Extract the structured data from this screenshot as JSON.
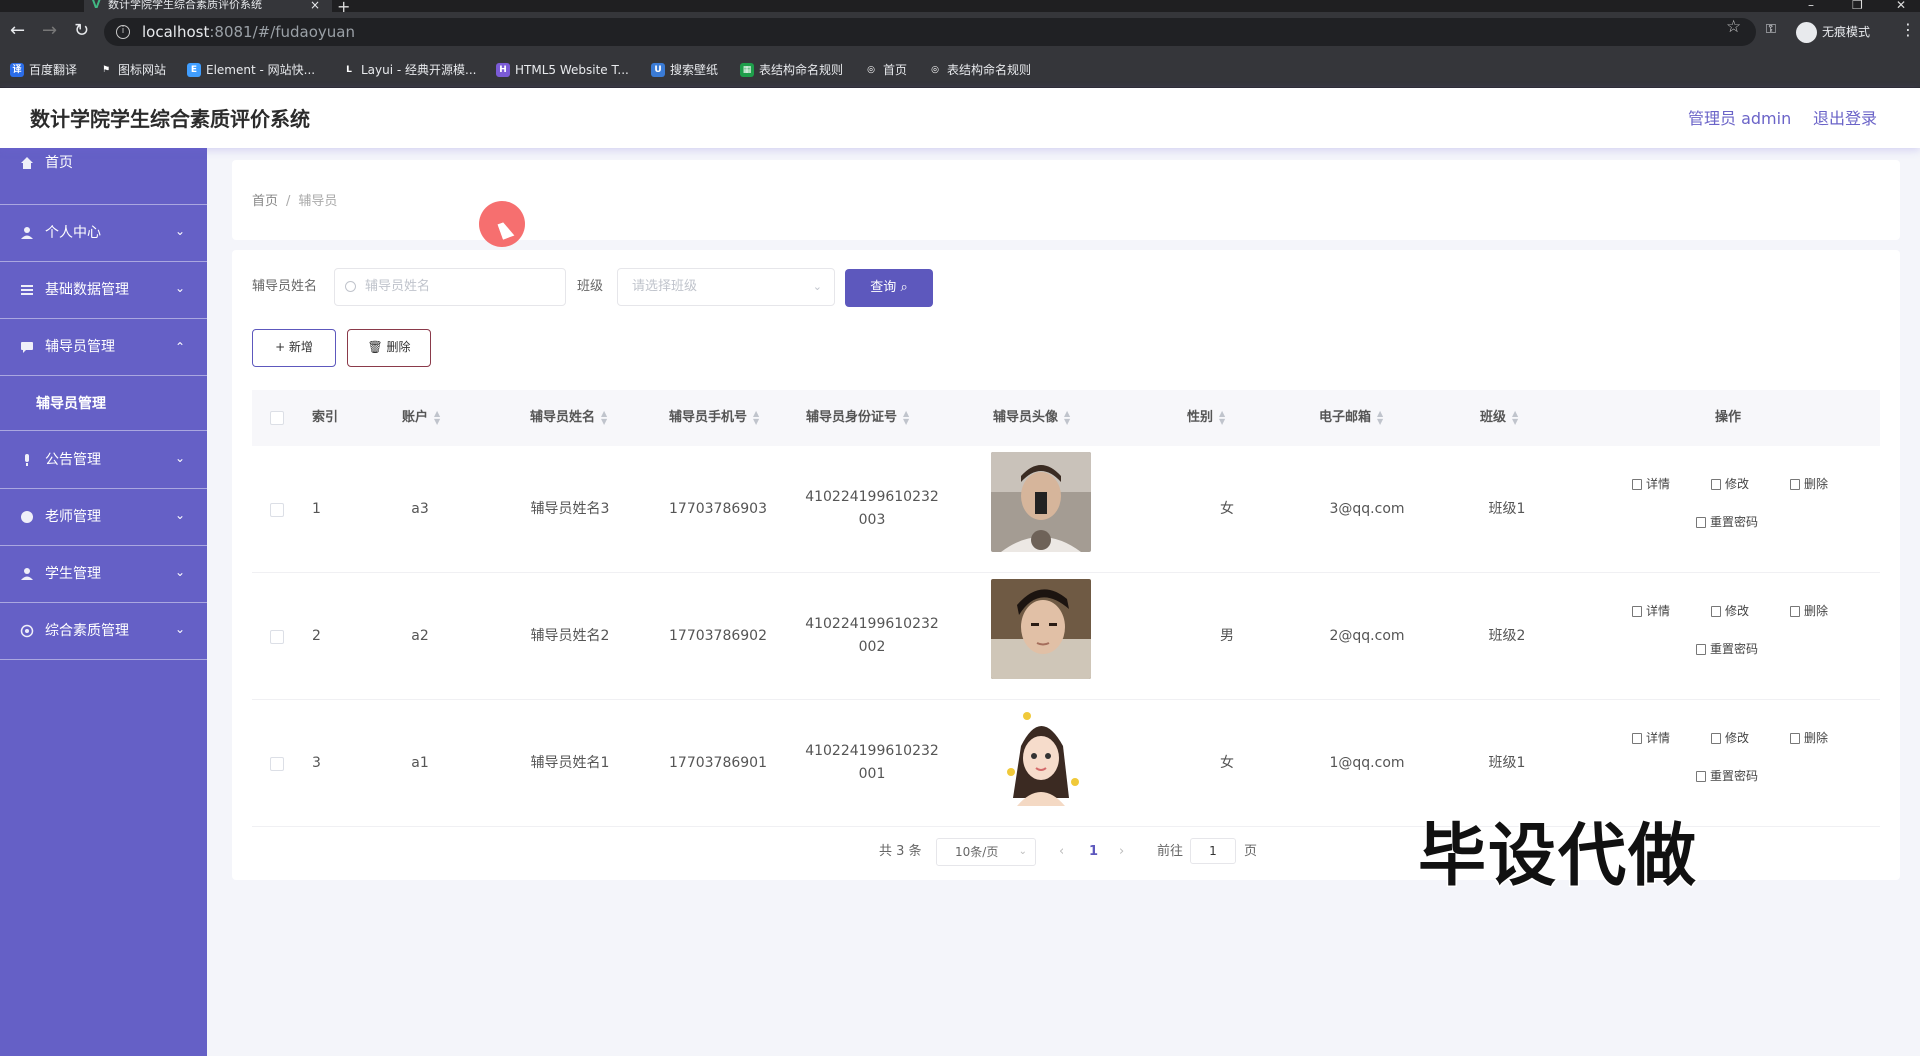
{
  "browser": {
    "tab_title": "数计学院学生综合素质评价系统",
    "url_host": "localhost",
    "url_path": ":8081/#/fudaoyuan",
    "incognito_label": "无痕模式",
    "bookmarks": [
      {
        "label": "百度翻译",
        "color": "#2b6de8"
      },
      {
        "label": "图标网站",
        "color": "#444"
      },
      {
        "label": "Element - 网站快...",
        "color": "#409eff"
      },
      {
        "label": "Layui - 经典开源模...",
        "color": "#444"
      },
      {
        "label": "HTML5 Website T...",
        "color": "#7b5bd6"
      },
      {
        "label": "搜索壁纸",
        "color": "#3a7bd5"
      },
      {
        "label": "表结构命名规则",
        "color": "#1e9e4a"
      },
      {
        "label": "首页",
        "color": "#555"
      },
      {
        "label": "表结构命名规则",
        "color": "#555"
      }
    ]
  },
  "header": {
    "title": "数计学院学生综合素质评价系统",
    "admin_label": "管理员 admin",
    "logout_label": "退出登录"
  },
  "sidebar": {
    "items": [
      {
        "label": "首页",
        "icon": "home-icon"
      },
      {
        "label": "个人中心",
        "icon": "user-icon"
      },
      {
        "label": "基础数据管理",
        "icon": "sliders-icon"
      },
      {
        "label": "辅导员管理",
        "icon": "chat-icon",
        "expanded": true
      },
      {
        "label": "公告管理",
        "icon": "mic-icon"
      },
      {
        "label": "老师管理",
        "icon": "palette-icon"
      },
      {
        "label": "学生管理",
        "icon": "user-icon"
      },
      {
        "label": "综合素质管理",
        "icon": "compass-icon"
      }
    ],
    "submenu_label": "辅导员管理"
  },
  "breadcrumb": {
    "home": "首页",
    "current": "辅导员"
  },
  "filters": {
    "name_label": "辅导员姓名",
    "name_placeholder": "辅导员姓名",
    "class_label": "班级",
    "class_placeholder": "请选择班级",
    "query_label": "查询"
  },
  "actions": {
    "add_label": "+ 新增",
    "delete_label": "删除"
  },
  "table": {
    "columns": [
      "索引",
      "账户",
      "辅导员姓名",
      "辅导员手机号",
      "辅导员身份证号",
      "辅导员头像",
      "性别",
      "电子邮箱",
      "班级",
      "操作"
    ],
    "rows": [
      {
        "index": "1",
        "account": "a3",
        "name": "辅导员姓名3",
        "phone": "17703786903",
        "id_line1": "410224199610232",
        "id_line2": "003",
        "gender": "女",
        "email": "3@qq.com",
        "class": "班级1"
      },
      {
        "index": "2",
        "account": "a2",
        "name": "辅导员姓名2",
        "phone": "17703786902",
        "id_line1": "410224199610232",
        "id_line2": "002",
        "gender": "男",
        "email": "2@qq.com",
        "class": "班级2"
      },
      {
        "index": "3",
        "account": "a1",
        "name": "辅导员姓名1",
        "phone": "17703786901",
        "id_line1": "410224199610232",
        "id_line2": "001",
        "gender": "女",
        "email": "1@qq.com",
        "class": "班级1"
      }
    ],
    "ops": {
      "detail": "详情",
      "edit": "修改",
      "delete": "删除",
      "reset": "重置密码"
    }
  },
  "pagination": {
    "total": "共 3 条",
    "page_size": "10条/页",
    "current_page": "1",
    "goto_prefix": "前往",
    "goto_value": "1",
    "goto_suffix": "页"
  },
  "overlay_text": "毕设代做",
  "colors": {
    "sidebar": "#6560c6",
    "primary": "#5d58bd",
    "accent_text": "#6b64c8"
  }
}
